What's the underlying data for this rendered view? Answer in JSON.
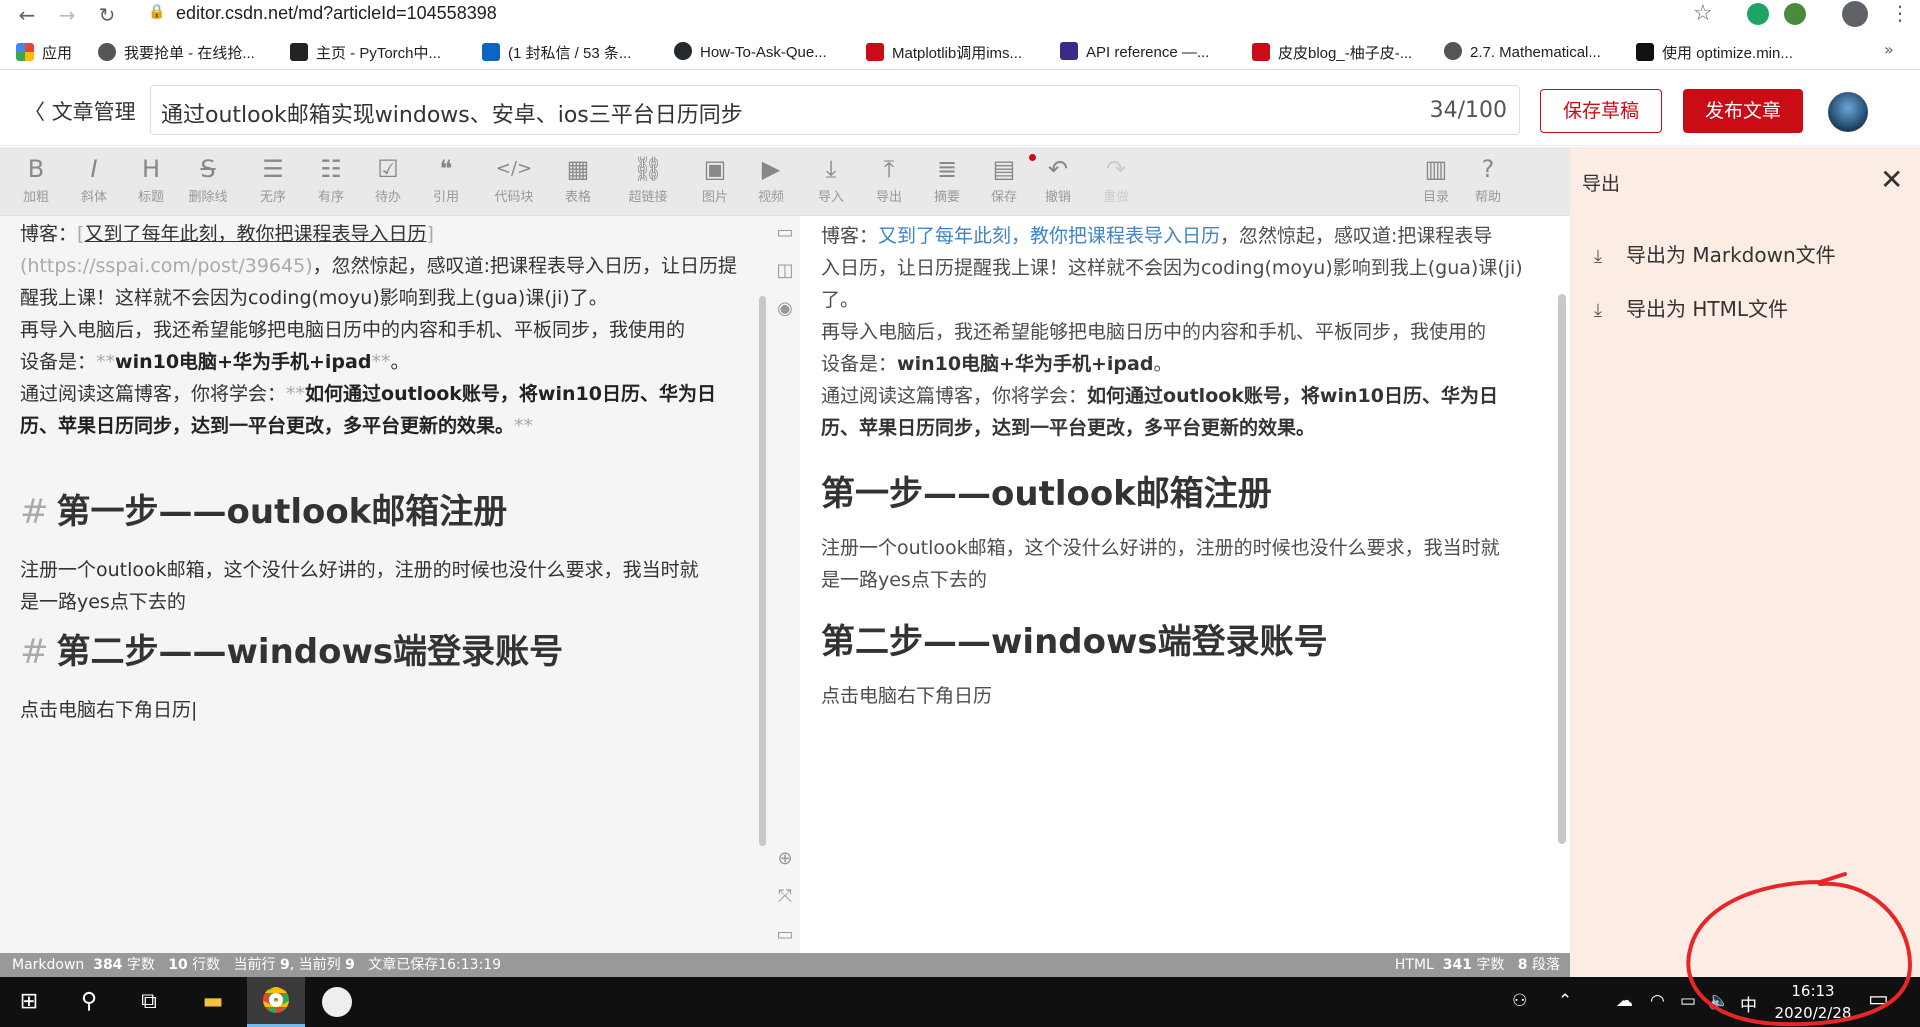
{
  "browser": {
    "url": "editor.csdn.net/md?articleId=104558398",
    "bookmarks": [
      {
        "label": "应用",
        "color": "#e94235"
      },
      {
        "label": "我要抢单 - 在线抢...",
        "color": "#555555"
      },
      {
        "label": "主页 - PyTorch中...",
        "color": "#222222"
      },
      {
        "label": "(1 封私信 / 53 条...",
        "color": "#0a66c2"
      },
      {
        "label": "How-To-Ask-Que...",
        "color": "#24292e"
      },
      {
        "label": "Matplotlib调用ims...",
        "color": "#ca0c16"
      },
      {
        "label": "API reference —...",
        "color": "#3b2a8a"
      },
      {
        "label": "皮皮blog_-柚子皮-...",
        "color": "#ca0c16"
      },
      {
        "label": "2.7. Mathematical...",
        "color": "#555555"
      },
      {
        "label": "使用 optimize.min...",
        "color": "#111111"
      }
    ]
  },
  "header": {
    "back_label": "文章管理",
    "title": "通过outlook邮箱实现windows、安卓、ios三平台日历同步",
    "title_count": "34/100",
    "save_draft": "保存草稿",
    "publish": "发布文章"
  },
  "toolbar": [
    {
      "icon": "B",
      "label": "加粗",
      "name": "bold"
    },
    {
      "icon": "I",
      "label": "斜体",
      "name": "italic"
    },
    {
      "icon": "H",
      "label": "标题",
      "name": "heading"
    },
    {
      "icon": "S",
      "label": "删除线",
      "name": "strikethrough"
    },
    {
      "icon": "☰",
      "label": "无序",
      "name": "unordered-list"
    },
    {
      "icon": "☷",
      "label": "有序",
      "name": "ordered-list"
    },
    {
      "icon": "☑",
      "label": "待办",
      "name": "todo"
    },
    {
      "icon": "❝",
      "label": "引用",
      "name": "quote"
    },
    {
      "icon": "</>",
      "label": "代码块",
      "name": "code-block"
    },
    {
      "icon": "▦",
      "label": "表格",
      "name": "table"
    },
    {
      "icon": "⛓",
      "label": "超链接",
      "name": "link"
    },
    {
      "icon": "▣",
      "label": "图片",
      "name": "image"
    },
    {
      "icon": "▶",
      "label": "视频",
      "name": "video"
    },
    {
      "icon": "⤓",
      "label": "导入",
      "name": "import"
    },
    {
      "icon": "⤒",
      "label": "导出",
      "name": "export"
    },
    {
      "icon": "≣",
      "label": "摘要",
      "name": "summary"
    },
    {
      "icon": "▤",
      "label": "保存",
      "name": "save"
    },
    {
      "icon": "↶",
      "label": "撤销",
      "name": "undo"
    },
    {
      "icon": "↷",
      "label": "重做",
      "name": "redo"
    },
    {
      "icon": "▥",
      "label": "目录",
      "name": "toc"
    },
    {
      "icon": "?",
      "label": "帮助",
      "name": "help"
    }
  ],
  "export_panel": {
    "title": "导出",
    "items": [
      "导出为 Markdown文件",
      "导出为 HTML文件"
    ]
  },
  "markdown": {
    "l1_prefix": "博客：",
    "l1_link": "又到了每年此刻，教你把课程表导入日历",
    "l2_url": "(https://sspai.com/post/39645)",
    "l2_rest": "，忽然惊起，感叹道:把课程表导入日历，让日历提",
    "l3": "醒我上课！这样就不会因为coding(moyu)影响到我上(gua)课(ji)了。",
    "l4": "再导入电脑后，我还希望能够把电脑日历中的内容和手机、平板同步，我使用的",
    "l5_prefix": "设备是：",
    "l5_bold": "win10电脑+华为手机+ipad",
    "l5_suffix": "。",
    "l6_prefix": "通过阅读这篇博客，你将学会：",
    "l6_bold": "如何通过outlook账号，将win10日历、华为日",
    "l7_bold": "历、苹果日历同步，达到一平台更改，多平台更新的效果。",
    "stars": "**",
    "hash": "#",
    "h1_1": "第一步——outlook邮箱注册",
    "p1_l1": "注册一个outlook邮箱，这个没什么好讲的，注册的时候也没什么要求，我当时就",
    "p1_l2": "是一路yes点下去的",
    "h1_2": "第二步——windows端登录账号",
    "p2": "点击电脑右下角日历"
  },
  "preview": {
    "l1_prefix": "博客：",
    "l1_link": "又到了每年此刻，教你把课程表导入日历",
    "l1_rest": "，忽然惊起，感叹道:把课程表导",
    "l2": "入日历，让日历提醒我上课！这样就不会因为coding(moyu)影响到我上(gua)课(ji)",
    "l3": "了。",
    "l4": "再导入电脑后，我还希望能够把电脑日历中的内容和手机、平板同步，我使用的",
    "l5_prefix": "设备是：",
    "l5_bold": "win10电脑+华为手机+ipad",
    "l5_suffix": "。",
    "l6_prefix": "通过阅读这篇博客，你将学会：",
    "l6_bold": "如何通过outlook账号，将win10日历、华为日",
    "l7_bold": "历、苹果日历同步，达到一平台更改，多平台更新的效果。",
    "h1_1": "第一步——outlook邮箱注册",
    "p1_l1": "注册一个outlook邮箱，这个没什么好讲的，注册的时候也没什么要求，我当时就",
    "p1_l2": "是一路yes点下去的",
    "h1_2": "第二步——windows端登录账号",
    "p2": "点击电脑右下角日历"
  },
  "status": {
    "md_label": "Markdown",
    "md_chars": "384",
    "chars_unit": "字数",
    "md_lines": "10",
    "lines_unit": "行数",
    "cur_line_label": "当前行",
    "cur_line": "9",
    "cur_col_label": ", 当前列",
    "cur_col": "9",
    "saved": "文章已保存16:13:19",
    "html_label": "HTML",
    "html_chars": "341",
    "html_paras": "8",
    "paras_unit": "段落"
  },
  "taskbar": {
    "ime": "中",
    "time": "16:13",
    "date": "2020/2/28"
  },
  "colors": {
    "accent": "#ca0c16",
    "link": "#4183c4",
    "panel_bg": "#fbede4",
    "annotation": "#e8262a"
  }
}
